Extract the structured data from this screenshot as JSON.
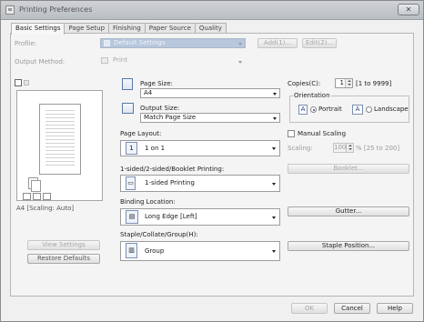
{
  "window": {
    "title": "Printing Preferences",
    "close_label": "✕"
  },
  "tabs": [
    {
      "label": "Basic Settings",
      "active": true
    },
    {
      "label": "Page Setup",
      "active": false
    },
    {
      "label": "Finishing",
      "active": false
    },
    {
      "label": "Paper Source",
      "active": false
    },
    {
      "label": "Quality",
      "active": false
    }
  ],
  "profile": {
    "label": "Profile:",
    "value": "Default Settings",
    "add_label": "Add(1)...",
    "edit_label": "Edit(2)..."
  },
  "output_method": {
    "label": "Output Method:",
    "value": "Print"
  },
  "preview": {
    "caption": "A4 [Scaling: Auto]"
  },
  "left_buttons": {
    "view_settings": "View Settings",
    "restore_defaults": "Restore Defaults"
  },
  "page_size": {
    "label": "Page Size:",
    "value": "A4"
  },
  "output_size": {
    "label": "Output Size:",
    "value": "Match Page Size"
  },
  "page_layout": {
    "label": "Page Layout:",
    "value": "1 on 1",
    "icon_text": "1"
  },
  "printing_mode": {
    "label": "1-sided/2-sided/Booklet Printing:",
    "value": "1-sided Printing"
  },
  "binding": {
    "label": "Binding Location:",
    "value": "Long Edge [Left]"
  },
  "staple": {
    "label": "Staple/Collate/Group(H):",
    "value": "Group"
  },
  "copies": {
    "label": "Copies(C):",
    "value": "1",
    "range": "[1 to 9999]"
  },
  "orientation": {
    "label": "Orientation",
    "portrait": "Portrait",
    "landscape": "Landscape",
    "selected": "Portrait"
  },
  "scaling": {
    "manual_label": "Manual Scaling",
    "label": "Scaling:",
    "value": "100",
    "range": "% [25 to 200]"
  },
  "right_buttons": {
    "booklet": "Booklet...",
    "gutter": "Gutter...",
    "staple_position": "Staple Position..."
  },
  "footer": {
    "ok": "OK",
    "cancel": "Cancel",
    "help": "Help"
  },
  "colors": {
    "panel": "#f4f4f4",
    "titlebar": "#c4c8cd",
    "accent": "#1b4f9c"
  }
}
